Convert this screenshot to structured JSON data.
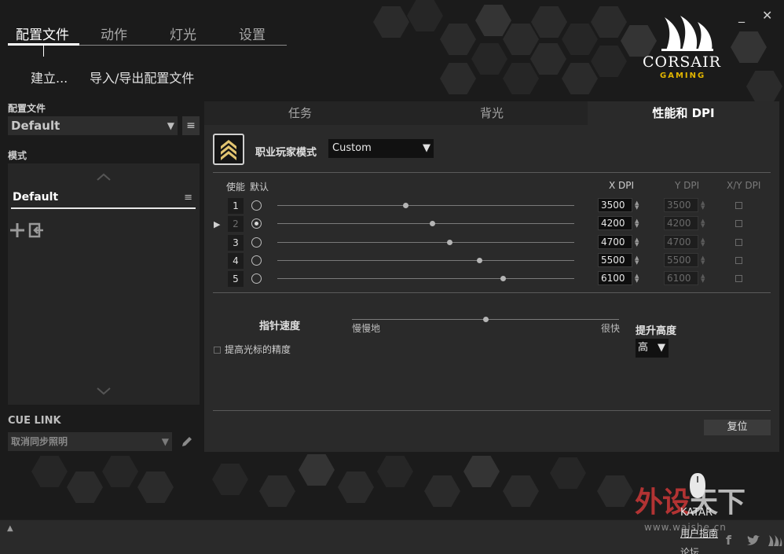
{
  "nav": {
    "tabs": [
      {
        "label": "配置文件"
      },
      {
        "label": "动作"
      },
      {
        "label": "灯光"
      },
      {
        "label": "设置"
      }
    ],
    "actions": {
      "create": "建立...",
      "import_export": "导入/导出配置文件"
    }
  },
  "window_controls": {
    "minimize": "_",
    "close": "✕"
  },
  "brand": {
    "name": "CORSAIR",
    "sub": "GAMING",
    "accent": "#e2b600"
  },
  "sidebar": {
    "profile_label": "配置文件",
    "profile_value": "Default",
    "mode_label": "模式",
    "mode_item": "Default",
    "cue_link_label": "CUE LINK",
    "cue_link_value": "取消同步照明"
  },
  "main": {
    "tabs": [
      {
        "label": "任务"
      },
      {
        "label": "背光"
      },
      {
        "label": "性能和 DPI"
      }
    ],
    "mode_name": "职业玩家模式",
    "mode_select": "Custom",
    "columns": {
      "enable": "使能",
      "default": "默认",
      "x_dpi": "X DPI",
      "y_dpi": "Y DPI",
      "xy_dpi": "X/Y DPI"
    },
    "dpi_rows": [
      {
        "num": "1",
        "x": "3500",
        "y": "3500",
        "default": false,
        "level": 0.43
      },
      {
        "num": "2",
        "x": "4200",
        "y": "4200",
        "default": true,
        "level": 0.52
      },
      {
        "num": "3",
        "x": "4700",
        "y": "4700",
        "default": false,
        "level": 0.58
      },
      {
        "num": "4",
        "x": "5500",
        "y": "5500",
        "default": false,
        "level": 0.68
      },
      {
        "num": "5",
        "x": "6100",
        "y": "6100",
        "default": false,
        "level": 0.76
      }
    ],
    "pointer_speed_label": "指针速度",
    "slow_label": "慢慢地",
    "fast_label": "很快",
    "pointer_speed_level": 0.5,
    "lift_height_label": "提升高度",
    "lift_height_value": "高",
    "precision_label": "提高光标的精度",
    "reset_label": "复位"
  },
  "bottom": {
    "device_name": "KATAR",
    "user_guide": "用户指南",
    "forum": "论坛"
  },
  "watermark": {
    "part1": "外设",
    "part2": "天下",
    "url": "www.waishe.cn"
  }
}
